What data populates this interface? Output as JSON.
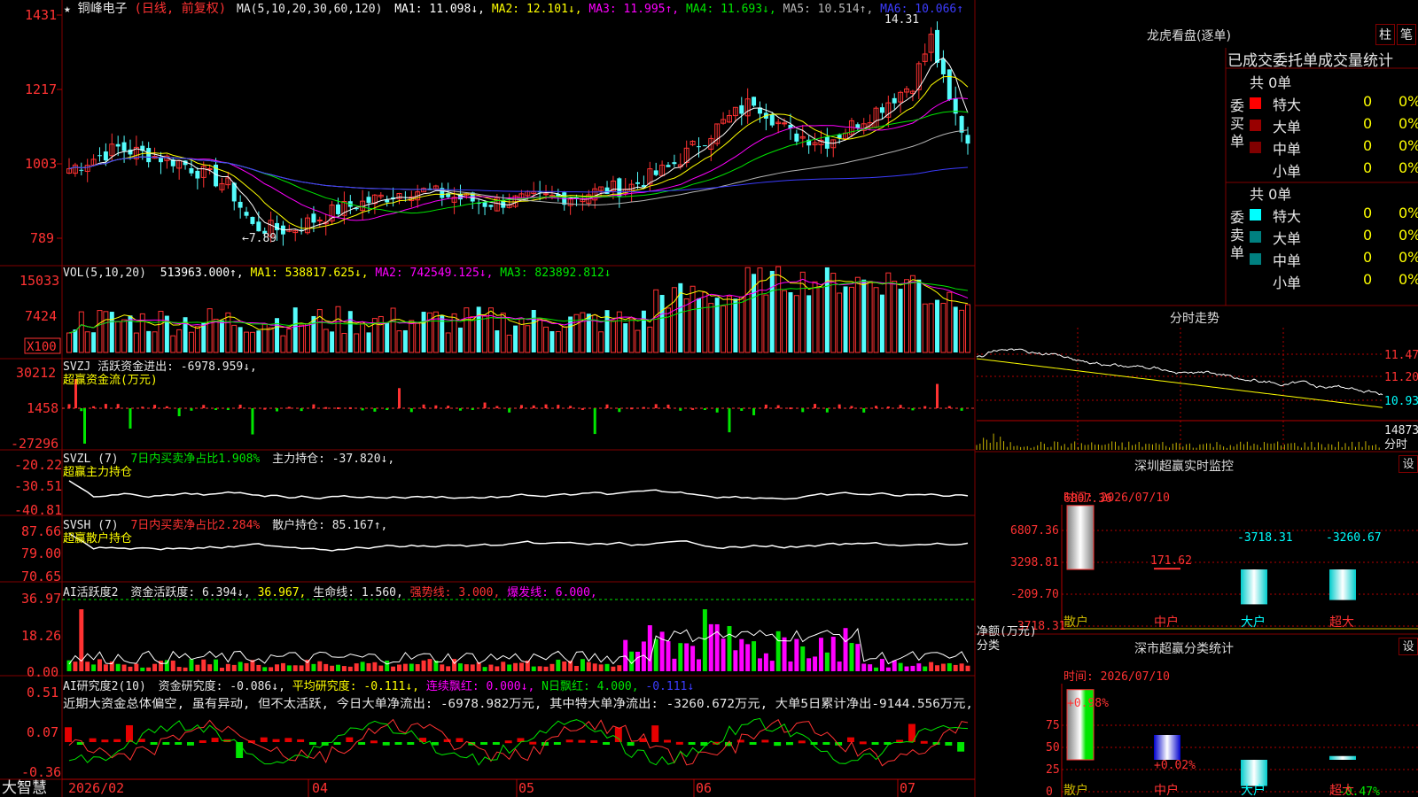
{
  "stock": {
    "star": "★",
    "name": "铜峰电子",
    "period": "(日线, 前复权)"
  },
  "main_ind": {
    "params": "MA(5,10,20,30,60,120)",
    "ma1": "MA1: 11.098↓,",
    "ma2": "MA2: 12.101↓,",
    "ma3": "MA3: 11.995↑,",
    "ma4": "MA4: 11.693↓,",
    "ma5": "MA5: 10.514↑,",
    "ma6": "MA6: 10.066↑",
    "y_labels": [
      "1431",
      "1217",
      "1003",
      "789"
    ],
    "high_label": "14.31",
    "low_label": "←7.89"
  },
  "vol_ind": {
    "params": "VOL(5,10,20)",
    "value": "513963.000↑,",
    "ma1": "MA1: 538817.625↓,",
    "ma2": "MA2: 742549.125↓,",
    "ma3": "MA3: 823892.812↓",
    "y_labels": [
      "15033",
      "7424"
    ],
    "unit": "X100"
  },
  "svzj": {
    "line1": "SVZJ  活跃资金进出: -6978.959↓,",
    "line2": "超赢资金流(万元)",
    "y_labels": [
      "30212",
      "1458",
      "-27296"
    ]
  },
  "svzl": {
    "name": "SVZL (7)",
    "desc": "7日内买卖净占比1.908%",
    "val": "主力持仓: -37.820↓,",
    "line2": "超赢主力持仓",
    "y_labels": [
      "-20.22",
      "-30.51",
      "-40.81"
    ]
  },
  "svsh": {
    "name": "SVSH (7)",
    "desc": "7日内买卖净占比2.284%",
    "val": "散户持仓: 85.167↑,",
    "line2": "超赢散户持仓",
    "y_labels": [
      "87.66",
      "79.00",
      "70.65"
    ]
  },
  "ai_active": {
    "name": "AI活跃度2",
    "v1": "资金活跃度: 6.394↓,",
    "v2": "36.967,",
    "v3": "生命线: 1.560,",
    "v4": "强势线: 3.000,",
    "v5": "爆发线: 6.000,",
    "y_labels": [
      "36.97",
      "18.26",
      "0.00"
    ]
  },
  "ai_research": {
    "name": "AI研究度2(10)",
    "v1": "资金研究度: -0.086↓,",
    "v2": "平均研究度: -0.111↓,",
    "v3": "连续飘红: 0.000↓,",
    "v4": "N日飘红: 4.000,",
    "v5": "-0.111↓",
    "comment": "近期大资金总体偏空, 虽有异动, 但不太活跃, 今日大单净流出: -6978.982万元, 其中特大单净流出: -3260.672万元, 大单5日累计净出-9144.556万元,",
    "y_labels": [
      "0.51",
      "0.07",
      "-0.36"
    ]
  },
  "x_axis": {
    "labels": [
      "2026/02",
      "04",
      "05",
      "06",
      "07"
    ]
  },
  "logo": "大智慧",
  "lhb": {
    "title": "龙虎看盘(逐单)",
    "btn_zhu": "柱",
    "btn_bi": "笔",
    "header": "已成交委托单成交量统计",
    "buy_label": "委买单",
    "sell_label": "委卖单",
    "buy_total": "共 0单",
    "sell_total": "共 0单",
    "buy_rows": [
      {
        "name": "特大",
        "count": "0",
        "pct": "0%",
        "color": "#ff0000"
      },
      {
        "name": "大单",
        "count": "0",
        "pct": "0%",
        "color": "#990000"
      },
      {
        "name": "中单",
        "count": "0",
        "pct": "0%",
        "color": "#800000"
      },
      {
        "name": "小单",
        "count": "0",
        "pct": "0%",
        "color": "#000000"
      }
    ],
    "sell_rows": [
      {
        "name": "特大",
        "count": "0",
        "pct": "0%",
        "color": "#00ffff"
      },
      {
        "name": "大单",
        "count": "0",
        "pct": "0%",
        "color": "#008080"
      },
      {
        "name": "中单",
        "count": "0",
        "pct": "0%",
        "color": "#008080"
      },
      {
        "name": "小单",
        "count": "0",
        "pct": "0%",
        "color": "#000000"
      }
    ]
  },
  "intraday": {
    "title": "分时走势",
    "y_labels": [
      "11.47",
      "11.20",
      "10.93"
    ],
    "vol_label": "14873",
    "bottom_label": "分时"
  },
  "sz_monitor": {
    "title": "深圳超赢实时监控",
    "set": "设",
    "time": "时间: 2026/07/10",
    "y_labels": [
      "6807.36",
      "3298.81",
      "-209.70",
      "-3718.31"
    ],
    "unit": "净额(万元)",
    "axis_label": "分类",
    "bars": [
      {
        "cat": "散户",
        "value": 6807.36,
        "label": "6807.36"
      },
      {
        "cat": "中户",
        "value": 171.62,
        "label": "171.62"
      },
      {
        "cat": "大户",
        "value": -3718.31,
        "label": "-3718.31"
      },
      {
        "cat": "超大",
        "value": -3260.67,
        "label": "-3260.67"
      }
    ]
  },
  "sz_stats": {
    "title": "深市超赢分类统计",
    "set": "设",
    "time": "时间: 2026/07/10",
    "y_labels": [
      "75",
      "50",
      "25",
      "0"
    ],
    "unit": "比例%",
    "axis_label": "分类",
    "bars": [
      {
        "cat": "散户",
        "top": "+0.98%",
        "value": 96.67,
        "label": "96.67"
      },
      {
        "cat": "中户",
        "top": "+0.02%",
        "value": 34.15,
        "label": "34.15"
      },
      {
        "cat": "大户",
        "top": "",
        "value": -36.01,
        "label": "-36.01"
      },
      {
        "cat": "超大",
        "top": "-0.47%",
        "value": 5.19,
        "label": "5.19"
      }
    ]
  },
  "colors": {
    "grid": "#b40000",
    "up": "#ff3232",
    "down": "#54fcfc",
    "ma1": "#ffffff",
    "ma2": "#ffff00",
    "ma3": "#ff00ff",
    "ma4": "#00e600",
    "ma5": "#b4b4b4",
    "ma6": "#3c3cff",
    "label_red": "#ff3232",
    "panel_border": "#800000"
  }
}
